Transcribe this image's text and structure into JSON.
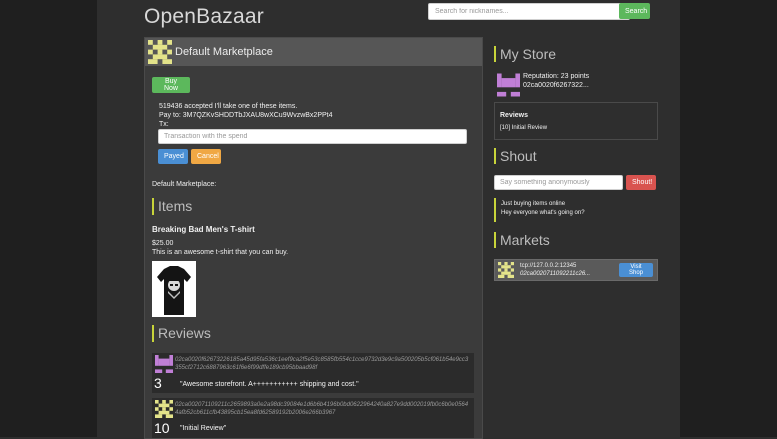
{
  "app": {
    "brand": "OpenBazaar"
  },
  "search": {
    "placeholder": "Search for nicknames...",
    "button_label": "Search"
  },
  "marketplace": {
    "title": "Default Marketplace",
    "buy_label": "Buy Now",
    "accept_msg": "519436 accepted I'll take one of these items.",
    "pay_to": "Pay to: 3M7QZKvSHDDTbJXAU8wXCu9WvzwBx2PPt4",
    "tx_label": "Tx:",
    "tx_placeholder": "Transaction with the spend",
    "payed_label": "Payed",
    "cancel_label": "Cancel",
    "dm_label": "Default Marketplace:"
  },
  "items": {
    "section_title": "Items",
    "list": [
      {
        "name": "Breaking Bad Men's T-shirt",
        "price": "$25.00",
        "description": "This is an awesome t-shirt that you can buy."
      }
    ]
  },
  "reviews": {
    "section_title": "Reviews",
    "list": [
      {
        "id": "02ca0020f62673226185a45d95fa536c1eef9ca2f5e53c8585fb554c1cce9732d3e9c9a500205b5cf061b54e9cc3355cf2712c6887963c61f6e6f99dffe189cb95bbaad98f",
        "score": "3",
        "text": "\"Awesome storefront. A+++++++++++ shipping and cost.\""
      },
      {
        "id": "02ca002071109211c2659893a0e2a98dc39084e1d6b6b4196b0bd0622964240a827e9dd002019fb0c6b0e05644afb52cb611cfb43895cb15ea8fd62589192b2006e266b3967",
        "score": "10",
        "text": "\"Initial Review\""
      }
    ]
  },
  "store": {
    "title": "My Store",
    "reputation": "Reputation: 23 points",
    "guid": "02ca0020f6267322...",
    "reviews_heading": "Reviews",
    "reviews_item": "[10] Initial Review"
  },
  "shout": {
    "title": "Shout",
    "placeholder": "Say something anonymously",
    "button_label": "Shout!",
    "messages": [
      "Just buying items online",
      "Hey everyone what's going on?"
    ]
  },
  "markets": {
    "title": "Markets",
    "list": [
      {
        "address": "tcp://127.0.0.2:12345",
        "guid": "02ca0020711092211c26...",
        "visit_label": "Visit Shop"
      }
    ]
  },
  "colors": {
    "accent": "#c8d43a",
    "success": "#5cb85c",
    "primary": "#4a8fd4",
    "warning": "#f0a844",
    "danger": "#d9534f"
  },
  "icons": {
    "avatar": "pixel-identicon-icon"
  }
}
